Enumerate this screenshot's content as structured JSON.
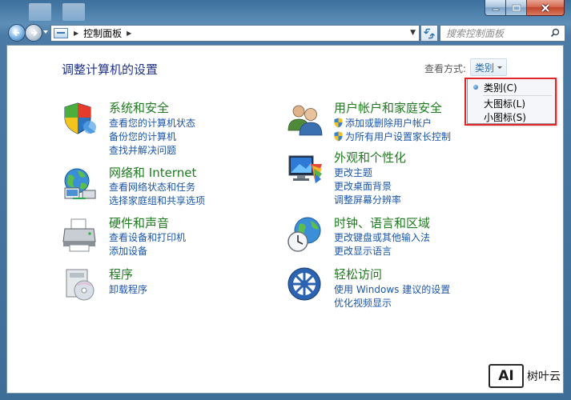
{
  "address": {
    "path": "控制面板"
  },
  "search": {
    "placeholder": "搜索控制面板"
  },
  "page": {
    "title": "调整计算机的设置"
  },
  "view_by": {
    "label": "查看方式:",
    "value": "类别"
  },
  "view_menu": {
    "items": [
      {
        "label": "类别(C)",
        "selected": true
      },
      {
        "label": "大图标(L)",
        "selected": false
      },
      {
        "label": "小图标(S)",
        "selected": false
      }
    ]
  },
  "categories": {
    "system": {
      "title": "系统和安全",
      "links": [
        "查看您的计算机状态",
        "备份您的计算机",
        "查找并解决问题"
      ]
    },
    "network": {
      "title": "网络和 Internet",
      "links": [
        "查看网络状态和任务",
        "选择家庭组和共享选项"
      ]
    },
    "hardware": {
      "title": "硬件和声音",
      "links": [
        "查看设备和打印机",
        "添加设备"
      ]
    },
    "programs": {
      "title": "程序",
      "links": [
        "卸载程序"
      ]
    },
    "users": {
      "title": "用户帐户和家庭安全",
      "links": [
        "添加或删除用户帐户",
        "为所有用户设置家长控制"
      ]
    },
    "appearance": {
      "title": "外观和个性化",
      "links": [
        "更改主题",
        "更改桌面背景",
        "调整屏幕分辨率"
      ]
    },
    "clock": {
      "title": "时钟、语言和区域",
      "links": [
        "更改键盘或其他输入法",
        "更改显示语言"
      ]
    },
    "access": {
      "title": "轻松访问",
      "links": [
        "使用 Windows 建议的设置",
        "优化视频显示"
      ]
    }
  },
  "watermark": {
    "logo": "AI",
    "text": "树叶云"
  },
  "colors": {
    "title_blue": "#1e3287",
    "category_green": "#1e7a1e",
    "link_blue": "#1a56a8",
    "highlight_red": "#e0262a"
  }
}
